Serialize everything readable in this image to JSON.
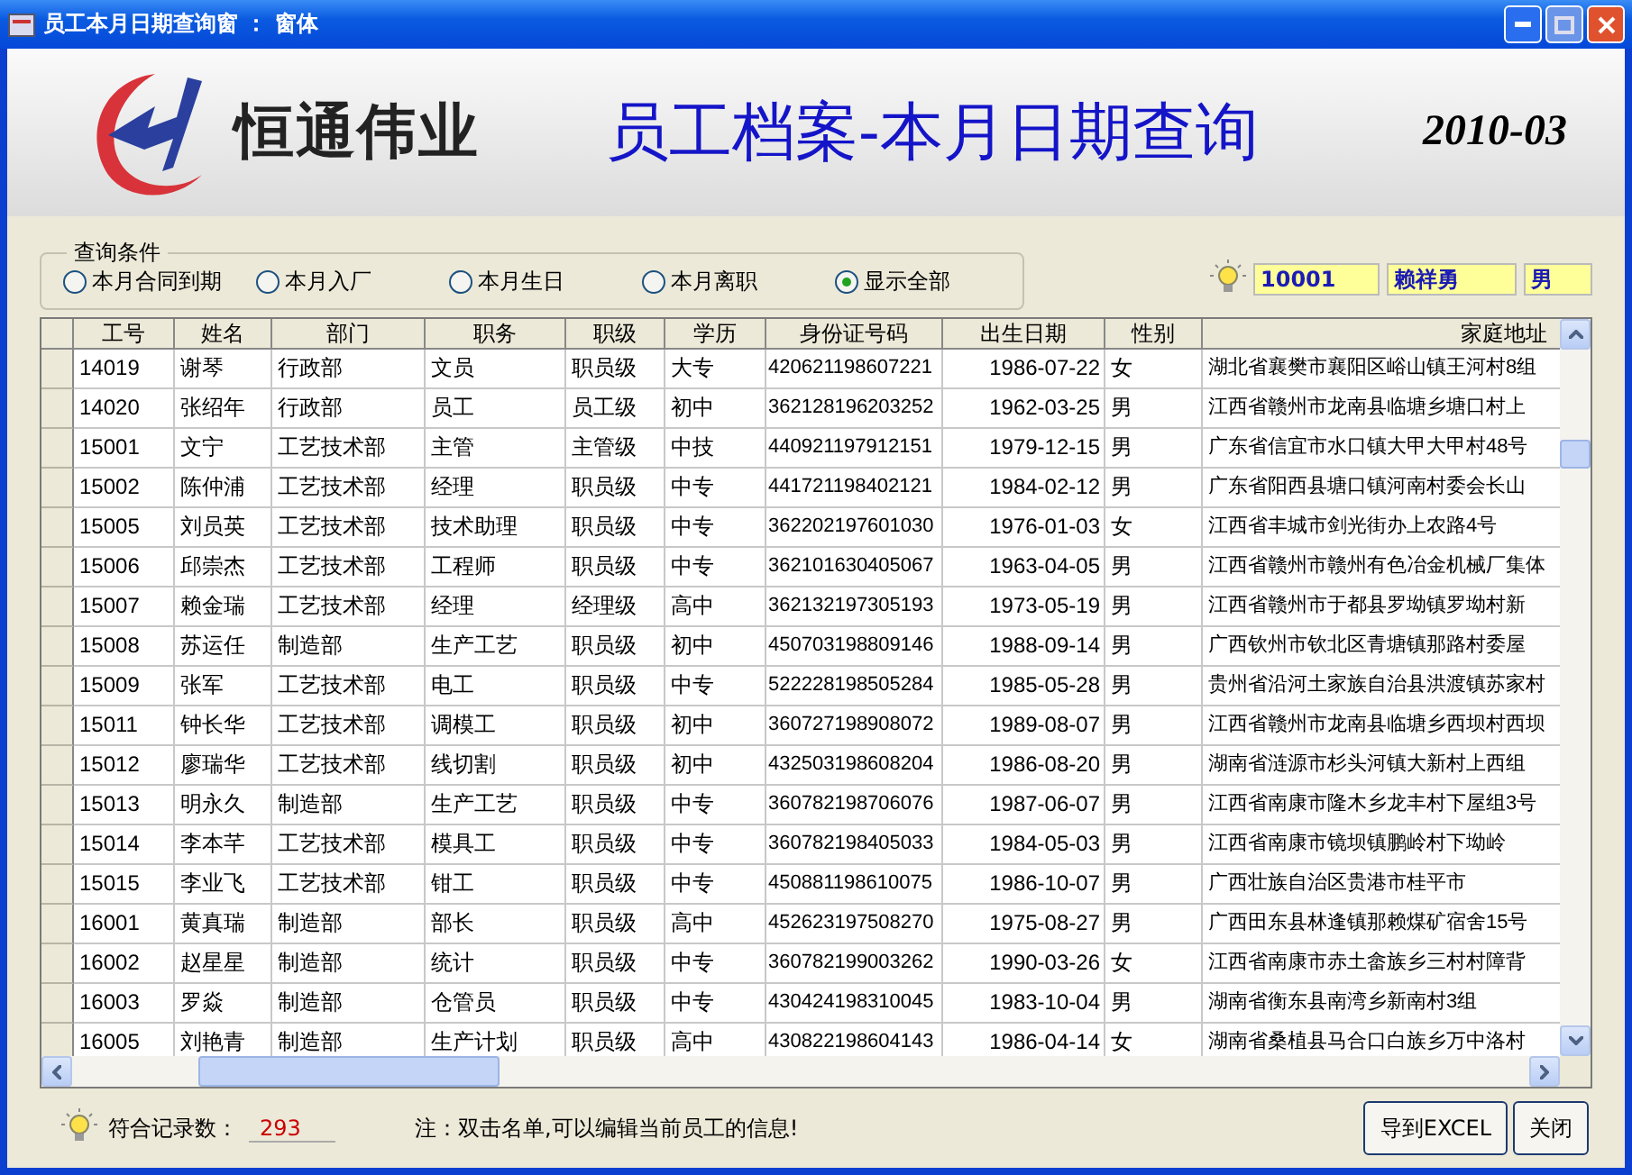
{
  "window": {
    "title": "员工本月日期查询窗 ： 窗体"
  },
  "header": {
    "company": "恒通伟业",
    "title": "员工档案-本月日期查询",
    "period": "2010-03"
  },
  "filter": {
    "label": "查询条件",
    "options": [
      {
        "label": "本月合同到期",
        "selected": false
      },
      {
        "label": "本月入厂",
        "selected": false
      },
      {
        "label": "本月生日",
        "selected": false
      },
      {
        "label": "本月离职",
        "selected": false
      },
      {
        "label": "显示全部",
        "selected": true
      }
    ]
  },
  "current": {
    "id": "10001",
    "name": "赖祥勇",
    "gender": "男"
  },
  "table": {
    "columns": [
      "工号",
      "姓名",
      "部门",
      "职务",
      "职级",
      "学历",
      "身份证号码",
      "出生日期",
      "性别",
      "家庭地址"
    ],
    "rows": [
      [
        "14019",
        "谢琴",
        "行政部",
        "文员",
        "职员级",
        "大专",
        "420621198607221",
        "1986-07-22",
        "女",
        "湖北省襄樊市襄阳区峪山镇王河村8组"
      ],
      [
        "14020",
        "张绍年",
        "行政部",
        "员工",
        "员工级",
        "初中",
        "362128196203252",
        "1962-03-25",
        "男",
        "江西省赣州市龙南县临塘乡塘口村上"
      ],
      [
        "15001",
        "文宁",
        "工艺技术部",
        "主管",
        "主管级",
        "中技",
        "440921197912151",
        "1979-12-15",
        "男",
        "广东省信宜市水口镇大甲大甲村48号"
      ],
      [
        "15002",
        "陈仲浦",
        "工艺技术部",
        "经理",
        "职员级",
        "中专",
        "441721198402121",
        "1984-02-12",
        "男",
        "广东省阳西县塘口镇河南村委会长山"
      ],
      [
        "15005",
        "刘员英",
        "工艺技术部",
        "技术助理",
        "职员级",
        "中专",
        "362202197601030",
        "1976-01-03",
        "女",
        "江西省丰城市剑光街办上农路4号"
      ],
      [
        "15006",
        "邱崇杰",
        "工艺技术部",
        "工程师",
        "职员级",
        "中专",
        "362101630405067",
        "1963-04-05",
        "男",
        "江西省赣州市赣州有色冶金机械厂集体"
      ],
      [
        "15007",
        "赖金瑞",
        "工艺技术部",
        "经理",
        "经理级",
        "高中",
        "362132197305193",
        "1973-05-19",
        "男",
        "江西省赣州市于都县罗坳镇罗坳村新"
      ],
      [
        "15008",
        "苏运任",
        "制造部",
        "生产工艺",
        "职员级",
        "初中",
        "450703198809146",
        "1988-09-14",
        "男",
        "广西钦州市钦北区青塘镇那路村委屋"
      ],
      [
        "15009",
        "张军",
        "工艺技术部",
        "电工",
        "职员级",
        "中专",
        "522228198505284",
        "1985-05-28",
        "男",
        "贵州省沿河土家族自治县洪渡镇苏家村"
      ],
      [
        "15011",
        "钟长华",
        "工艺技术部",
        "调模工",
        "职员级",
        "初中",
        "360727198908072",
        "1989-08-07",
        "男",
        "江西省赣州市龙南县临塘乡西坝村西坝"
      ],
      [
        "15012",
        "廖瑞华",
        "工艺技术部",
        "线切割",
        "职员级",
        "初中",
        "432503198608204",
        "1986-08-20",
        "男",
        "湖南省涟源市杉头河镇大新村上西组"
      ],
      [
        "15013",
        "明永久",
        "制造部",
        "生产工艺",
        "职员级",
        "中专",
        "360782198706076",
        "1987-06-07",
        "男",
        "江西省南康市隆木乡龙丰村下屋组3号"
      ],
      [
        "15014",
        "李本芊",
        "工艺技术部",
        "模具工",
        "职员级",
        "中专",
        "360782198405033",
        "1984-05-03",
        "男",
        "江西省南康市镜坝镇鹏岭村下坳岭"
      ],
      [
        "15015",
        "李业飞",
        "工艺技术部",
        "钳工",
        "职员级",
        "中专",
        "450881198610075",
        "1986-10-07",
        "男",
        "广西壮族自治区贵港市桂平市"
      ],
      [
        "16001",
        "黄真瑞",
        "制造部",
        "部长",
        "职员级",
        "高中",
        "452623197508270",
        "1975-08-27",
        "男",
        "广西田东县林逢镇那赖煤矿宿舍15号"
      ],
      [
        "16002",
        "赵星星",
        "制造部",
        "统计",
        "职员级",
        "中专",
        "360782199003262",
        "1990-03-26",
        "女",
        "江西省南康市赤土畲族乡三村村障背"
      ],
      [
        "16003",
        "罗焱",
        "制造部",
        "仓管员",
        "职员级",
        "中专",
        "430424198310045",
        "1983-10-04",
        "男",
        "湖南省衡东县南湾乡新南村3组"
      ],
      [
        "16005",
        "刘艳青",
        "制造部",
        "生产计划",
        "职员级",
        "高中",
        "430822198604143",
        "1986-04-14",
        "女",
        "湖南省桑植县马合口白族乡万中洛村"
      ]
    ]
  },
  "footer": {
    "count_label": "符合记录数：",
    "count": "293",
    "note": "注：双击名单,可以编辑当前员工的信息!",
    "buttons": [
      "导到EXCEL",
      "关闭"
    ]
  }
}
